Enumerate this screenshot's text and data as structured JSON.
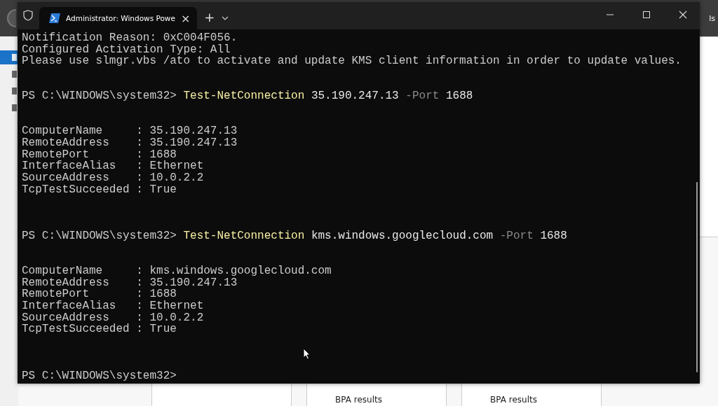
{
  "background_app": {
    "header_text": "ls",
    "sidebar": [
      {
        "selected": true
      },
      {
        "selected": false
      },
      {
        "selected": false
      },
      {
        "selected": false
      }
    ],
    "cards": [
      {
        "kind": "blank"
      },
      {
        "kind": "link",
        "label": "BPA results"
      },
      {
        "kind": "link",
        "label": "BPA results"
      }
    ]
  },
  "terminal": {
    "tabs": [
      {
        "title": "Administrator: Windows Powe",
        "close_glyph": "×",
        "selected": true
      }
    ],
    "new_tab_glyph": "+",
    "lines": [
      {
        "kind": "text",
        "text": "Notification Reason: 0xC004F056."
      },
      {
        "kind": "text",
        "text": "Configured Activation Type: All"
      },
      {
        "kind": "text",
        "text": "Please use slmgr.vbs /ato to activate and update KMS client information in order to update values."
      },
      {
        "kind": "blank"
      },
      {
        "kind": "blank"
      },
      {
        "kind": "prompt",
        "prompt": "PS C:\\WINDOWS\\system32>",
        "command": "Test-NetConnection",
        "argument": "35.190.247.13",
        "parameter": "-Port",
        "value": "1688"
      },
      {
        "kind": "blank"
      },
      {
        "kind": "blank"
      },
      {
        "kind": "text",
        "text": "ComputerName     : 35.190.247.13"
      },
      {
        "kind": "text",
        "text": "RemoteAddress    : 35.190.247.13"
      },
      {
        "kind": "text",
        "text": "RemotePort       : 1688"
      },
      {
        "kind": "text",
        "text": "InterfaceAlias   : Ethernet"
      },
      {
        "kind": "text",
        "text": "SourceAddress    : 10.0.2.2"
      },
      {
        "kind": "text",
        "text": "TcpTestSucceeded : True"
      },
      {
        "kind": "blank"
      },
      {
        "kind": "blank"
      },
      {
        "kind": "blank"
      },
      {
        "kind": "prompt",
        "prompt": "PS C:\\WINDOWS\\system32>",
        "command": "Test-NetConnection",
        "argument": "kms.windows.googlecloud.com",
        "parameter": "-Port",
        "value": "1688"
      },
      {
        "kind": "blank"
      },
      {
        "kind": "blank"
      },
      {
        "kind": "text",
        "text": "ComputerName     : kms.windows.googlecloud.com"
      },
      {
        "kind": "text",
        "text": "RemoteAddress    : 35.190.247.13"
      },
      {
        "kind": "text",
        "text": "RemotePort       : 1688"
      },
      {
        "kind": "text",
        "text": "InterfaceAlias   : Ethernet"
      },
      {
        "kind": "text",
        "text": "SourceAddress    : 10.0.2.2"
      },
      {
        "kind": "text",
        "text": "TcpTestSucceeded : True"
      },
      {
        "kind": "blank"
      },
      {
        "kind": "blank"
      },
      {
        "kind": "blank"
      },
      {
        "kind": "prompt",
        "prompt": "PS C:\\WINDOWS\\system32>"
      }
    ]
  }
}
